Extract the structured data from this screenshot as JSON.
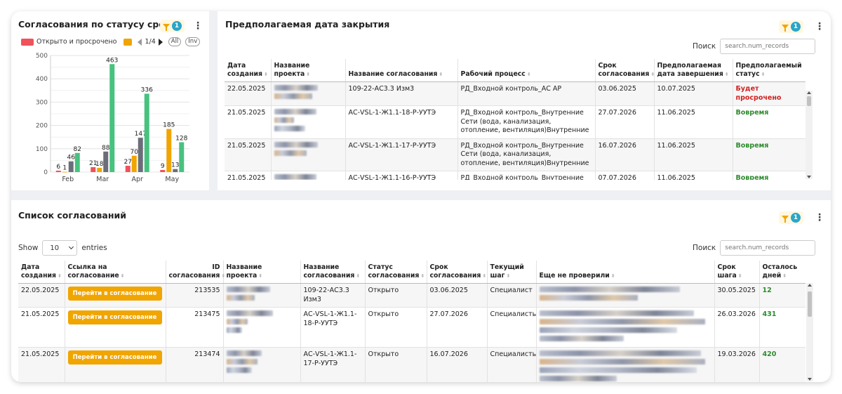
{
  "chart_panel": {
    "title": "Согласования по статусу срока",
    "filter_count": "1",
    "legend_label": "Открыто и просрочено",
    "page_indicator": "1/4",
    "pill_all": "All",
    "pill_inv": "Inv",
    "colors": {
      "red": "#f0525a",
      "orange": "#f0a500",
      "gray": "#6b6e78",
      "green": "#47c27f"
    }
  },
  "chart_data": {
    "type": "bar",
    "categories": [
      "Feb",
      "Mar",
      "Apr",
      "May"
    ],
    "ylim": [
      0,
      500
    ],
    "yticks": [
      0,
      100,
      200,
      300,
      400,
      500
    ],
    "series": [
      {
        "name": "Открыто и просрочено",
        "color": "#f0525a",
        "values": [
          6,
          21,
          27,
          9
        ]
      },
      {
        "color": "#f0a500",
        "values": [
          1,
          18,
          70,
          185
        ]
      },
      {
        "color": "#6b6e78",
        "values": [
          46,
          88,
          147,
          13
        ]
      },
      {
        "color": "#47c27f",
        "values": [
          82,
          463,
          336,
          128
        ]
      }
    ]
  },
  "closing_panel": {
    "title": "Предполагаемая дата закрытия",
    "filter_count": "1",
    "search_label": "Поиск",
    "search_placeholder": "search.num_records",
    "columns": [
      "Дата создания",
      "Название проекта",
      "Название согласования",
      "Рабочий процесс",
      "Срок согласования",
      "Предполагаемая дата завершения",
      "Предполагаемый статус"
    ],
    "rows": [
      {
        "date": "22.05.2025",
        "approval": "109-22-АС3.3 Изм3",
        "process": "РД_Входной контроль_АС АР",
        "deadline": "03.06.2025",
        "expected": "10.07.2025",
        "status": "Будет просрочено"
      },
      {
        "date": "21.05.2025",
        "approval": "АС-VSL-1-Ж1.1-18-Р-УУТЭ",
        "process": "РД_Входной контроль_Внутренние Сети (вода, канализация, отопление, вентиляция)Внутренние",
        "deadline": "27.07.2026",
        "expected": "11.06.2025",
        "status": "Вовремя"
      },
      {
        "date": "21.05.2025",
        "approval": "АС-VSL-1-Ж1.1-17-Р-УУТЭ",
        "process": "РД_Входной контроль_Внутренние Сети (вода, канализация, отопление, вентиляция)Внутренние",
        "deadline": "16.07.2026",
        "expected": "11.06.2025",
        "status": "Вовремя"
      },
      {
        "date": "21.05.2025",
        "approval": "АС-VSL-1-Ж1.1-16-Р-УУТЭ",
        "process": "РД_Входной контроль_Внутренние Сети",
        "deadline": "07.07.2026",
        "expected": "11.06.2025",
        "status": "Вовремя"
      }
    ]
  },
  "list_panel": {
    "title": "Список согласований",
    "filter_count": "1",
    "show_label": "Show",
    "entries_label": "entries",
    "page_size": "10",
    "search_label": "Поиск",
    "search_placeholder": "search.num_records",
    "columns": [
      "Дата создания",
      "Ссылка на согласование",
      "ID согласования",
      "Название проекта",
      "Название согласования",
      "Статус согласования",
      "Срок согласования",
      "Текущий шаг",
      "Еще не проверили",
      "Срок шага",
      "Осталось дней"
    ],
    "button_label": "Перейти в согласование",
    "rows": [
      {
        "date": "22.05.2025",
        "id": "213535",
        "approval": "109-22-АС3.3 Изм3",
        "status": "Открыто",
        "deadline": "03.06.2025",
        "step": "Специалист",
        "step_deadline": "30.05.2025",
        "days": "12"
      },
      {
        "date": "21.05.2025",
        "id": "213475",
        "approval": "АС-VSL-1-Ж1.1-18-Р-УУТЭ",
        "status": "Открыто",
        "deadline": "27.07.2026",
        "step": "Специалисты",
        "step_deadline": "26.03.2026",
        "days": "431"
      },
      {
        "date": "21.05.2025",
        "id": "213474",
        "approval": "АС-VSL-1-Ж1.1-17-Р-УУТЭ",
        "status": "Открыто",
        "deadline": "16.07.2026",
        "step": "Специалисты",
        "step_deadline": "19.03.2026",
        "days": "420"
      }
    ]
  }
}
